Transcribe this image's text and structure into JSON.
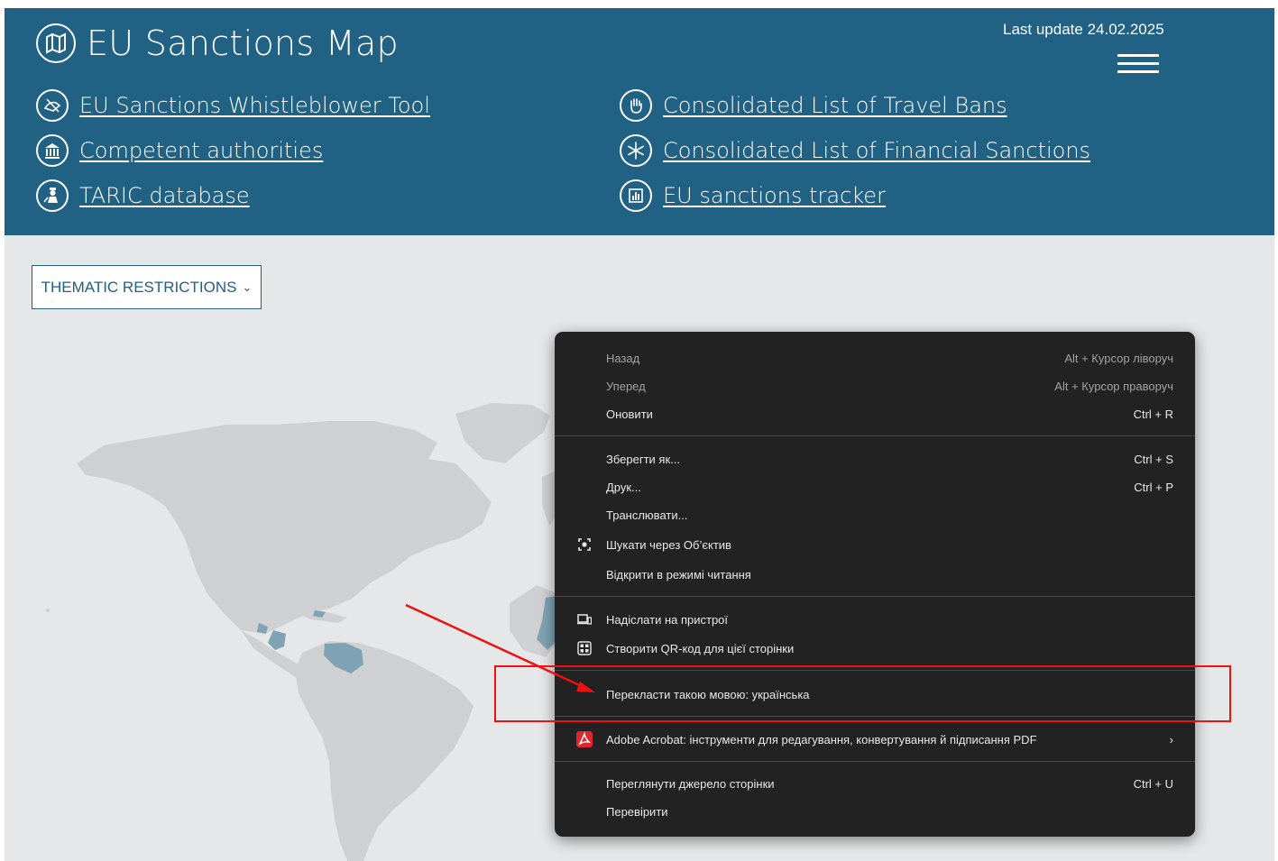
{
  "header": {
    "title": "EU Sanctions Map",
    "last_update": "Last update 24.02.2025",
    "links_left": [
      {
        "label": "EU Sanctions Whistleblower Tool",
        "icon": "whistleblower-icon"
      },
      {
        "label": "Competent authorities",
        "icon": "institution-icon"
      },
      {
        "label": "TARIC database",
        "icon": "customs-officer-icon"
      }
    ],
    "links_right": [
      {
        "label": "Consolidated List of Travel Bans",
        "icon": "stop-hand-icon"
      },
      {
        "label": "Consolidated List of Financial Sanctions",
        "icon": "frozen-assets-icon"
      },
      {
        "label": "EU sanctions tracker",
        "icon": "bar-chart-icon"
      }
    ]
  },
  "filters": {
    "thematic_label": "THEMATIC RESTRICTIONS"
  },
  "context_menu": {
    "items": [
      {
        "label": "Назад",
        "shortcut": "Alt + Курсор ліворуч",
        "enabled": false
      },
      {
        "label": "Уперед",
        "shortcut": "Alt + Курсор праворуч",
        "enabled": false
      },
      {
        "label": "Оновити",
        "shortcut": "Ctrl + R",
        "enabled": true
      },
      {
        "label": "Зберегти як...",
        "shortcut": "Ctrl + S",
        "enabled": true
      },
      {
        "label": "Друк...",
        "shortcut": "Ctrl + P",
        "enabled": true
      },
      {
        "label": "Транслювати...",
        "shortcut": "",
        "enabled": true
      },
      {
        "label": "Шукати через Об’єктив",
        "shortcut": "",
        "icon": "lens-icon",
        "enabled": true
      },
      {
        "label": "Відкрити в режимі читання",
        "shortcut": "",
        "enabled": true
      },
      {
        "label": "Надіслати на пристрої",
        "shortcut": "",
        "icon": "devices-icon",
        "enabled": true
      },
      {
        "label": "Створити QR-код для цієї сторінки",
        "shortcut": "",
        "icon": "qr-code-icon",
        "enabled": true
      },
      {
        "label": "Перекласти такою мовою: українська",
        "shortcut": "",
        "enabled": true,
        "highlighted": true
      },
      {
        "label": "Adobe Acrobat: інструменти для редагування, конвертування й підписання PDF",
        "shortcut": "›",
        "icon": "acrobat-icon",
        "enabled": true
      },
      {
        "label": "Переглянути джерело сторінки",
        "shortcut": "Ctrl + U",
        "enabled": true
      },
      {
        "label": "Перевірити",
        "shortcut": "",
        "enabled": true
      }
    ]
  },
  "colors": {
    "header_bg": "#206184",
    "page_bg": "#e6e7e8",
    "land": "#cfd0d1",
    "sanctioned": "#7fa3b4",
    "menu_bg": "#222222",
    "annotation_red": "#ee1111"
  }
}
